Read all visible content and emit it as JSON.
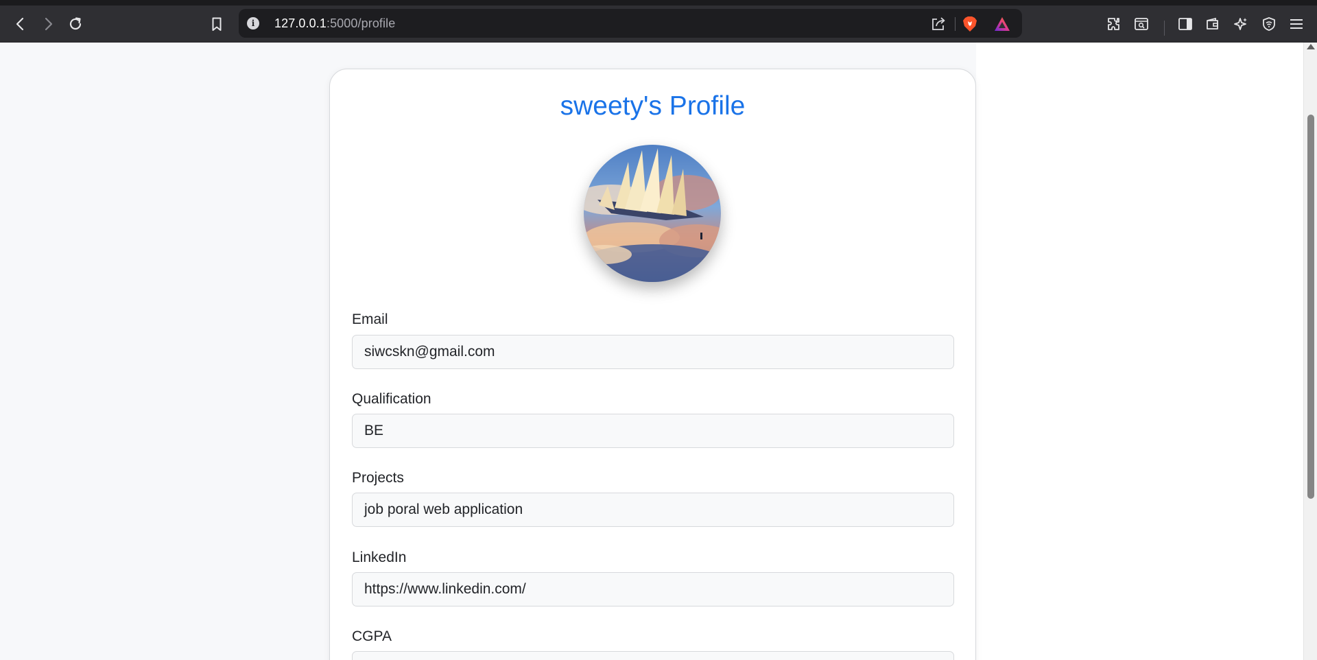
{
  "browser": {
    "url_host": "127.0.0.1",
    "url_rest": ":5000/profile",
    "icons": [
      "back-icon",
      "forward-icon",
      "reload-icon",
      "bookmark-icon",
      "site-info-icon",
      "share-icon",
      "brave-shields-icon",
      "brave-rewards-icon",
      "extensions-icon",
      "page-search-icon",
      "sidebar-icon",
      "wallet-icon",
      "leo-ai-icon",
      "vpn-icon",
      "menu-icon"
    ]
  },
  "profile": {
    "title": "sweety's Profile",
    "fields": [
      {
        "label": "Email",
        "value": "siwcskn@gmail.com"
      },
      {
        "label": "Qualification",
        "value": "BE"
      },
      {
        "label": "Projects",
        "value": "job poral web application"
      },
      {
        "label": "LinkedIn",
        "value": "https://www.linkedin.com/"
      },
      {
        "label": "CGPA",
        "value": ""
      }
    ]
  },
  "colors": {
    "title": "#1a73e8",
    "chrome": "#2f2f33",
    "page_bg": "#f7f8fa"
  }
}
